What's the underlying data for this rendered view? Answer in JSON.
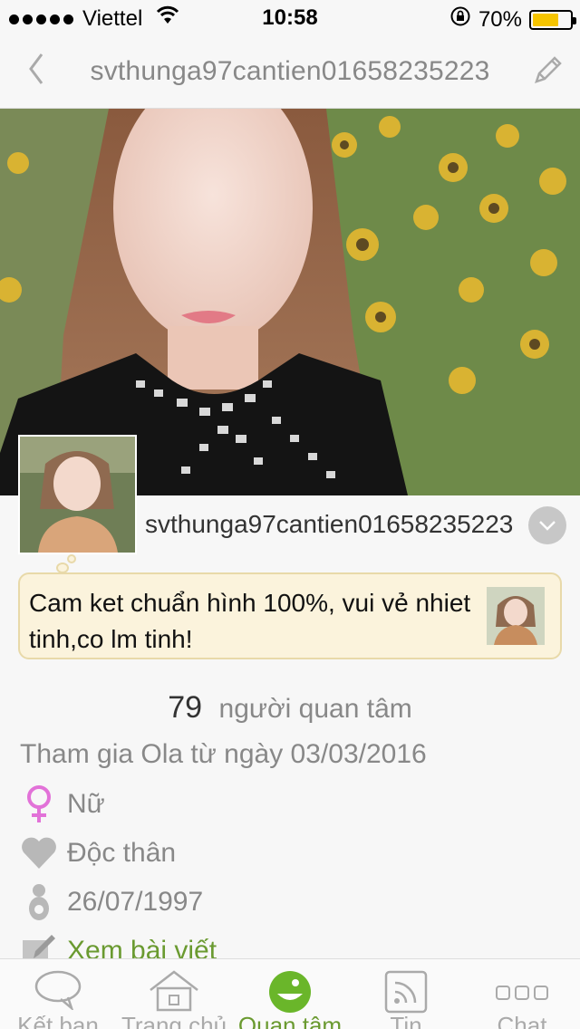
{
  "status_bar": {
    "carrier": "Viettel",
    "time": "10:58",
    "battery_percent": "70%",
    "battery_level": 0.7
  },
  "header": {
    "title": "svthunga97cantien01658235223"
  },
  "profile": {
    "username": "svthunga97cantien01658235223",
    "status_text": "Cam ket chuẩn hình 100%, vui vẻ nhiet tinh,co lm tinh!",
    "followers_count": "79",
    "followers_label": "người quan tâm",
    "joined_text": "Tham gia Ola từ ngày 03/03/2016",
    "gender": "Nữ",
    "relationship": "Độc thân",
    "birthday": "26/07/1997",
    "posts_link": "Xem bài viết"
  },
  "tab_bar": {
    "tabs": [
      {
        "label": "Kết bạn",
        "icon": "chat-bubble-icon"
      },
      {
        "label": "Trang chủ",
        "icon": "home-icon"
      },
      {
        "label": "Quan tâm",
        "icon": "smile-icon"
      },
      {
        "label": "Tin",
        "icon": "feed-icon"
      },
      {
        "label": "Chat",
        "icon": "more-icon"
      }
    ]
  },
  "colors": {
    "accent_green": "#6a9a30",
    "battery": "#f5c400",
    "bubble_bg": "#fbf3dc",
    "female_pink": "#e272d8"
  }
}
